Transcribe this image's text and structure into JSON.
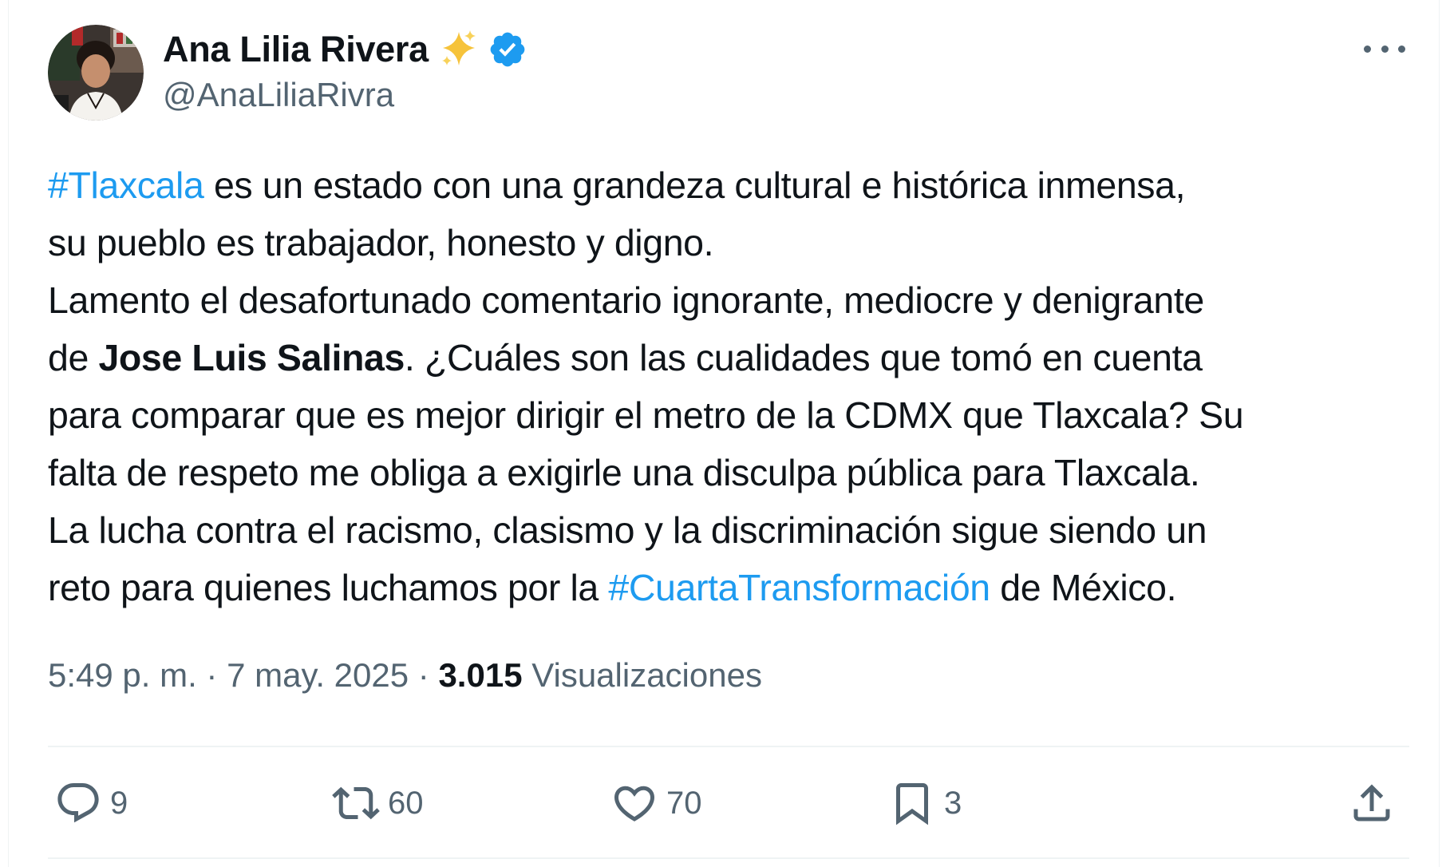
{
  "author": {
    "display_name": "Ana Lilia Rivera",
    "handle": "@AnaLiliaRivra",
    "avatar_icon": "avatar-photo",
    "badge_icons": [
      "sparkles-icon",
      "verified-badge-icon"
    ],
    "verified_color": "#1d9bf0"
  },
  "tweet": {
    "lines": {
      "l1_hashtag": "#Tlaxcala",
      "l1_text": " es un estado con una grandeza cultural e histórica inmensa,",
      "l2_text": "su pueblo es trabajador, honesto y digno.",
      "l3_text": "Lamento el desafortunado comentario ignorante, mediocre y denigrante",
      "l4_prefix": "de ",
      "l4_bold": "Jose Luis Salinas",
      "l4_suffix": ". ¿Cuáles son las cualidades que tomó en cuenta",
      "l5_text": "para comparar que es mejor dirigir el metro de la CDMX que Tlaxcala? Su",
      "l6_text": "falta de respeto me obliga a exigirle una disculpa pública para Tlaxcala.",
      "l7_text": "La lucha contra el racismo, clasismo y la discriminación sigue siendo un",
      "l8_prefix": "reto para quienes luchamos por la ",
      "l8_hashtag": "#CuartaTransformación",
      "l8_suffix": " de México."
    },
    "hashtag_color": "#1d9bf0"
  },
  "meta": {
    "time": "5:49 p. m.",
    "separator": " · ",
    "date": "7 may. 2025",
    "views_count": "3.015",
    "views_label": " Visualizaciones"
  },
  "actions": {
    "replies": {
      "icon": "reply-icon",
      "count": "9"
    },
    "reposts": {
      "icon": "repost-icon",
      "count": "60"
    },
    "likes": {
      "icon": "like-icon",
      "count": "70"
    },
    "bookmarks": {
      "icon": "bookmark-icon",
      "count": "3"
    },
    "share": {
      "icon": "share-icon"
    }
  },
  "colors": {
    "text": "#0f1419",
    "secondary": "#536471",
    "accent": "#1d9bf0",
    "divider": "#eff3f4"
  }
}
